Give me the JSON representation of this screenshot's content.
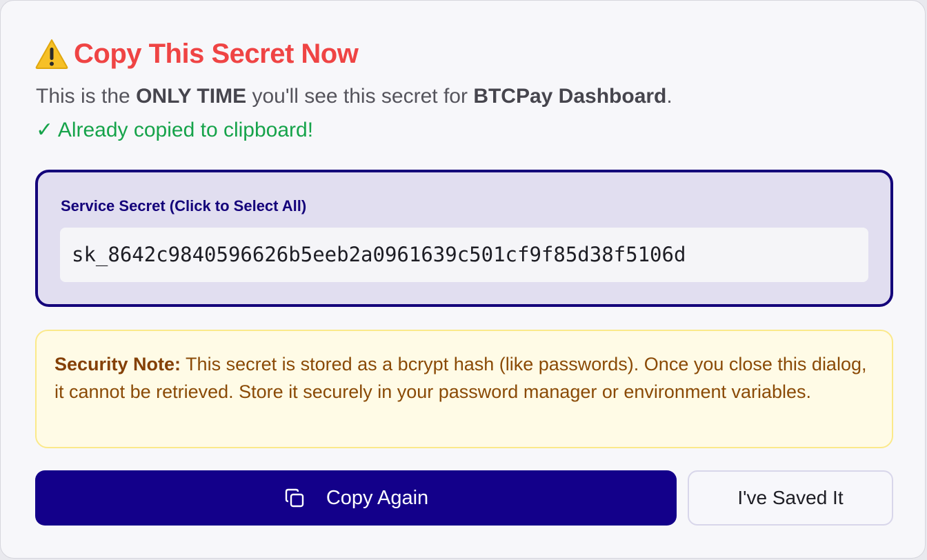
{
  "dialog": {
    "title_icon": "warning-icon",
    "title": "Copy This Secret Now",
    "desc_prefix": "This is the ",
    "desc_emphasis": "ONLY TIME",
    "desc_middle": " you'll see this secret for ",
    "service_name": "BTCPay Dashboard",
    "desc_suffix": ".",
    "copied_status": "✓ Already copied to clipboard!"
  },
  "secret": {
    "label": "Service Secret (Click to Select All)",
    "value": "sk_8642c9840596626b5eeb2a0961639c501cf9f85d38f5106d"
  },
  "note": {
    "label": "Security Note:",
    "text": " This secret is stored as a bcrypt hash (like passwords). Once you close this dialog, it cannot be retrieved. Store it securely in your password manager or environment variables."
  },
  "actions": {
    "copy_icon": "copy-icon",
    "copy_again_label": "Copy Again",
    "saved_label": "I've Saved It"
  },
  "colors": {
    "title": "#ef4444",
    "success": "#16a34a",
    "primary": "#13008a",
    "note_bg": "#fffbe6",
    "note_text": "#8a4a06"
  }
}
